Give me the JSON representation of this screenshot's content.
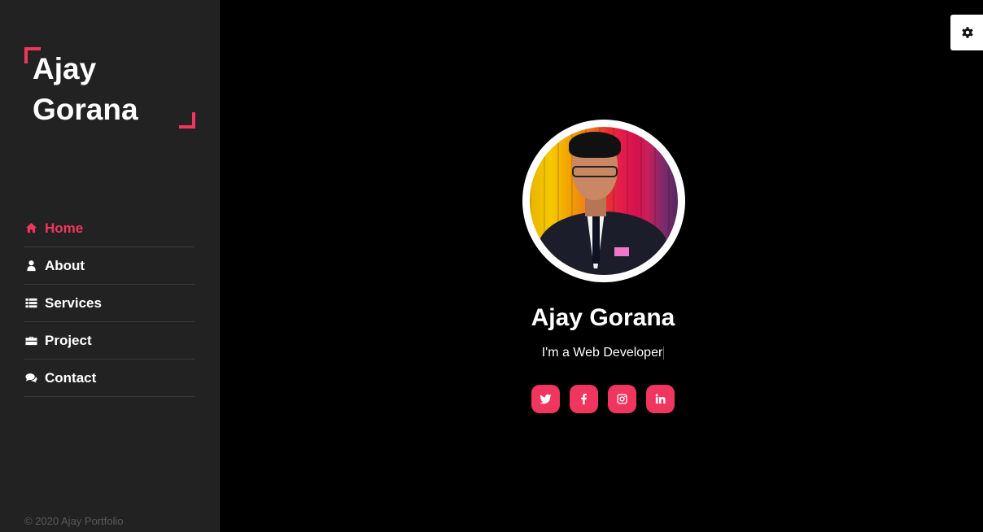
{
  "sidebar": {
    "logo": "Ajay\nGorana",
    "nav": [
      {
        "label": "Home",
        "icon": "home-icon",
        "active": true
      },
      {
        "label": "About",
        "icon": "user-icon",
        "active": false
      },
      {
        "label": "Services",
        "icon": "list-icon",
        "active": false
      },
      {
        "label": "Project",
        "icon": "briefcase-icon",
        "active": false
      },
      {
        "label": "Contact",
        "icon": "comments-icon",
        "active": false
      }
    ],
    "copyright": "© 2020 Ajay Portfolio"
  },
  "hero": {
    "name": "Ajay Gorana",
    "tagline": "I'm a Web Developer",
    "socials": [
      {
        "icon": "twitter-icon"
      },
      {
        "icon": "facebook-icon"
      },
      {
        "icon": "instagram-icon"
      },
      {
        "icon": "linkedin-icon"
      }
    ]
  },
  "settings": {
    "icon": "gear-icon"
  },
  "colors": {
    "accent": "#f0365f",
    "sidebar_bg": "#222222",
    "main_bg": "#000000"
  }
}
